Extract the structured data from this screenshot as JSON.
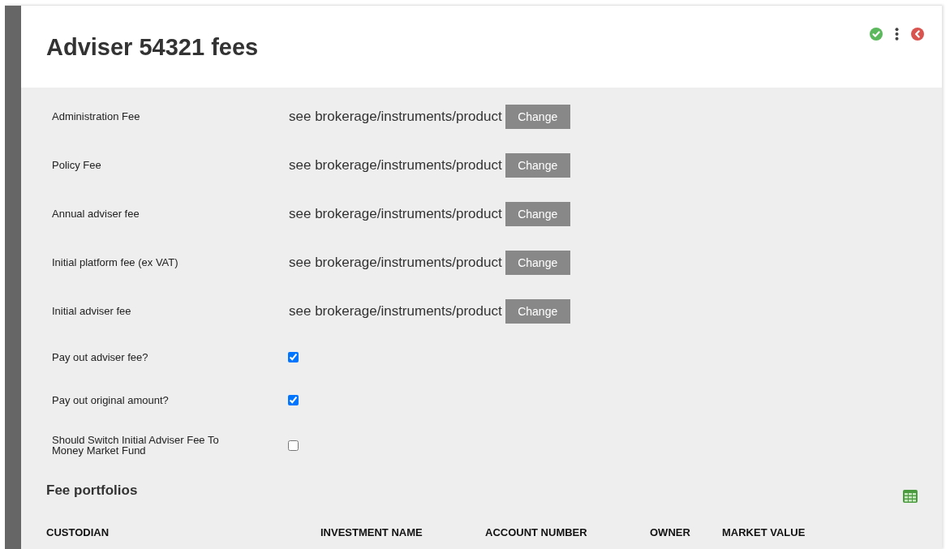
{
  "page": {
    "title": "Adviser 54321 fees"
  },
  "fields": [
    {
      "kind": "text",
      "label": "Administration Fee",
      "value": "see brokerage/instruments/product",
      "button": "Change"
    },
    {
      "kind": "text",
      "label": "Policy Fee",
      "value": "see brokerage/instruments/product",
      "button": "Change"
    },
    {
      "kind": "text",
      "label": "Annual adviser fee",
      "value": "see brokerage/instruments/product",
      "button": "Change"
    },
    {
      "kind": "text",
      "label": "Initial platform fee (ex VAT)",
      "value": "see brokerage/instruments/product",
      "button": "Change"
    },
    {
      "kind": "text",
      "label": "Initial adviser fee",
      "value": "see brokerage/instruments/product",
      "button": "Change"
    },
    {
      "kind": "checkbox",
      "label": "Pay out adviser fee?",
      "checked": true
    },
    {
      "kind": "checkbox",
      "label": "Pay out original amount?",
      "checked": true
    },
    {
      "kind": "checkbox",
      "label": "Should Switch Initial Adviser Fee To Money Market Fund",
      "checked": false
    }
  ],
  "fee_portfolios": {
    "title": "Fee portfolios",
    "columns": [
      "CUSTODIAN",
      "INVESTMENT NAME",
      "ACCOUNT NUMBER",
      "OWNER",
      "MARKET VALUE"
    ]
  }
}
